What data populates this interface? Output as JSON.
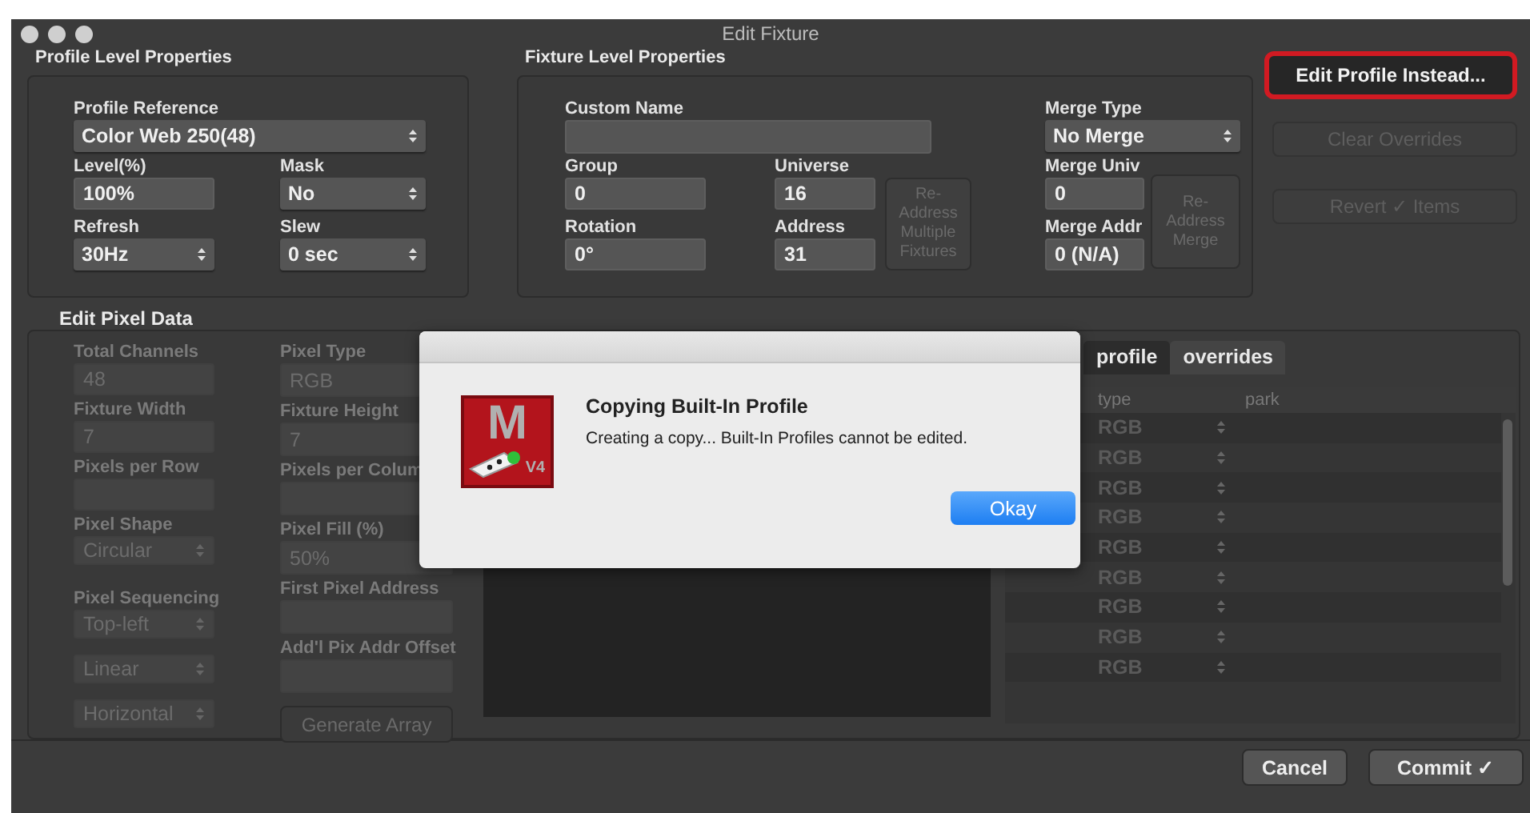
{
  "window": {
    "title": "Edit Fixture"
  },
  "profile_level_properties": {
    "heading": "Profile Level Properties",
    "profile_reference": {
      "label": "Profile Reference",
      "kind": "select",
      "value": "Color Web 250(48)",
      "disabled": false
    },
    "level": {
      "label": "Level(%)",
      "kind": "text",
      "value": "100%",
      "disabled": false
    },
    "mask": {
      "label": "Mask",
      "kind": "select",
      "value": "No",
      "disabled": false
    },
    "refresh": {
      "label": "Refresh",
      "kind": "select",
      "value": "30Hz",
      "disabled": false
    },
    "slew": {
      "label": "Slew",
      "kind": "select",
      "value": "0 sec",
      "disabled": false
    }
  },
  "fixture_level_properties": {
    "heading": "Fixture Level Properties",
    "custom_name": {
      "label": "Custom Name",
      "kind": "text",
      "disabled": false
    },
    "group": {
      "label": "Group",
      "kind": "text",
      "value": "0",
      "disabled": false
    },
    "universe": {
      "label": "Universe",
      "kind": "text",
      "value": "16",
      "disabled": false
    },
    "rotation": {
      "label": "Rotation",
      "kind": "text",
      "value": "0°",
      "disabled": false
    },
    "address": {
      "label": "Address",
      "kind": "text",
      "value": "31",
      "disabled": false
    },
    "readdress_button": {
      "label": "Re-Address Multiple Fixtures",
      "disabled": true
    },
    "merge_type": {
      "label": "Merge Type",
      "kind": "select",
      "value": "No Merge",
      "disabled": false
    },
    "merge_univ": {
      "label": "Merge Univ",
      "kind": "text",
      "value": "0",
      "disabled": false
    },
    "merge_addr": {
      "label": "Merge Addr",
      "kind": "text",
      "value": "0 (N/A)",
      "disabled": false
    },
    "readdress_merge_button": {
      "label": "Re-Address Merge",
      "disabled": true
    }
  },
  "side_buttons": [
    {
      "label": "Edit Profile Instead...",
      "disabled": false,
      "highlighted": true
    },
    {
      "label": "Clear Overrides",
      "disabled": true,
      "highlighted": false
    },
    {
      "label": "Revert ✓ Items",
      "disabled": true,
      "highlighted": false
    }
  ],
  "edit_pixel_data": {
    "heading": "Edit Pixel Data",
    "column_1": [
      {
        "label": "Total Channels",
        "kind": "text",
        "value": "48",
        "disabled": true
      },
      {
        "label": "Fixture Width",
        "kind": "text",
        "value": "7",
        "disabled": true
      },
      {
        "label": "Pixels per Row",
        "kind": "text",
        "disabled": true
      },
      {
        "label": "Pixel Shape",
        "kind": "select",
        "value": "Circular",
        "disabled": true
      },
      {
        "label": "Pixel Sequencing",
        "kind": "select",
        "value": "Top-left",
        "disabled": true
      },
      {
        "kind": "select",
        "value": "Linear",
        "disabled": true
      },
      {
        "kind": "select",
        "value": "Horizontal",
        "disabled": true
      }
    ],
    "column_2": [
      {
        "label": "Pixel Type",
        "kind": "text",
        "value": "RGB",
        "disabled": true
      },
      {
        "label": "Fixture Height",
        "kind": "text",
        "value": "7",
        "disabled": true
      },
      {
        "label": "Pixels per Colum",
        "kind": "text",
        "disabled": true
      },
      {
        "label": "Pixel Fill (%)",
        "kind": "text",
        "value": "50%",
        "disabled": true
      },
      {
        "label": "First Pixel Address",
        "kind": "text",
        "disabled": true
      },
      {
        "label": "Add'l Pix Addr Offset",
        "kind": "text",
        "disabled": true
      },
      {
        "kind": "button",
        "value": "Generate Array",
        "disabled": true
      }
    ],
    "tabs": [
      {
        "label": "profile",
        "selected": true
      },
      {
        "label": "overrides",
        "selected": false
      }
    ],
    "table": {
      "columns": [
        "type",
        "park"
      ],
      "rows": [
        {
          "type": "RGB",
          "disabled": true
        },
        {
          "type": "RGB",
          "disabled": true
        },
        {
          "type": "RGB",
          "disabled": true
        },
        {
          "type": "RGB",
          "disabled": true
        },
        {
          "type": "RGB",
          "disabled": true
        },
        {
          "type": "RGB",
          "disabled": true
        },
        {
          "type": "RGB",
          "disabled": true
        },
        {
          "type": "RGB",
          "disabled": true
        },
        {
          "type": "RGB",
          "disabled": true
        }
      ]
    }
  },
  "footer_buttons": [
    {
      "label": "Cancel"
    },
    {
      "label": "Commit ✓"
    }
  ],
  "dialog": {
    "logo_letter": "M",
    "logo_badge": "V4",
    "title": "Copying Built-In Profile",
    "message": "Creating a copy... Built-In Profiles cannot be edited.",
    "button": "Okay"
  }
}
